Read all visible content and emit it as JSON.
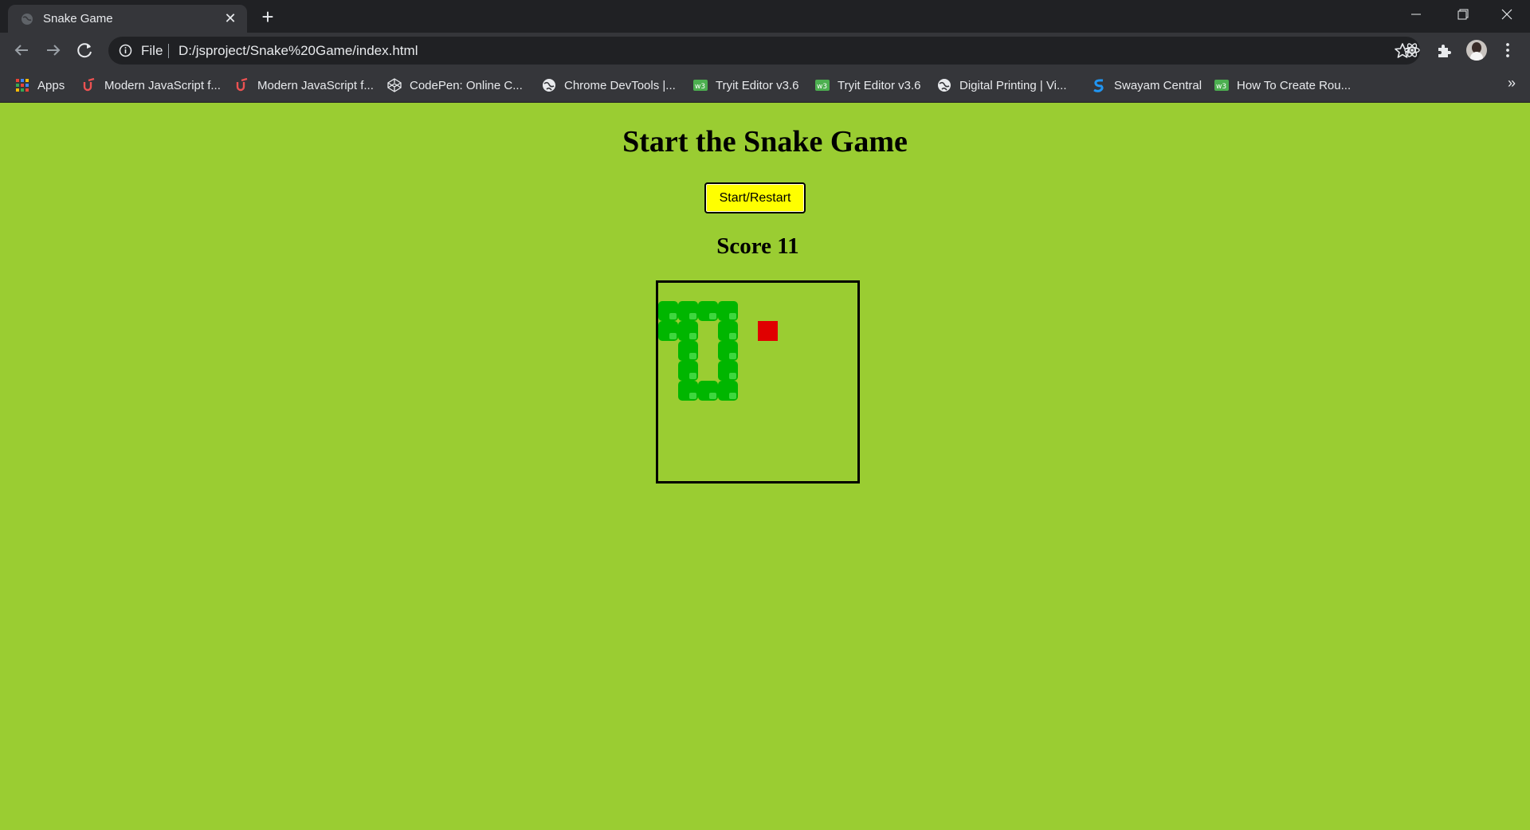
{
  "browser": {
    "tab_title": "Snake Game",
    "address_scheme": "File",
    "url": "D:/jsproject/Snake%20Game/index.html",
    "bookmarks": [
      {
        "label": "Apps",
        "icon": "apps-grid-icon"
      },
      {
        "label": "Modern JavaScript f...",
        "icon": "udemy-icon"
      },
      {
        "label": "Modern JavaScript f...",
        "icon": "udemy-icon"
      },
      {
        "label": "CodePen: Online C...",
        "icon": "codepen-icon"
      },
      {
        "label": "Chrome DevTools |...",
        "icon": "globe-icon"
      },
      {
        "label": "Tryit Editor v3.6",
        "icon": "w3schools-icon"
      },
      {
        "label": "Tryit Editor v3.6",
        "icon": "w3schools-icon"
      },
      {
        "label": "Digital Printing | Vi...",
        "icon": "globe-icon"
      },
      {
        "label": "Swayam Central",
        "icon": "swayam-icon"
      },
      {
        "label": "How To Create Rou...",
        "icon": "w3schools-icon"
      }
    ],
    "more_bookmarks": "»"
  },
  "page": {
    "title": "Start the Snake Game",
    "button_label": "Start/Restart",
    "score_label": "Score",
    "score_value": "11",
    "background_color": "#9acd32",
    "button_color": "#ffff00",
    "snake_color": "#00b600",
    "food_color": "#e00000"
  },
  "game": {
    "grid_cols": 10,
    "grid_rows": 10,
    "snake_cells": [
      [
        0,
        0
      ],
      [
        1,
        0
      ],
      [
        2,
        0
      ],
      [
        3,
        0
      ],
      [
        0,
        1
      ],
      [
        1,
        1
      ],
      [
        3,
        1
      ],
      [
        1,
        2
      ],
      [
        3,
        2
      ],
      [
        1,
        3
      ],
      [
        3,
        3
      ],
      [
        1,
        4
      ],
      [
        2,
        4
      ],
      [
        3,
        4
      ]
    ],
    "food_cell": [
      5,
      1
    ]
  }
}
